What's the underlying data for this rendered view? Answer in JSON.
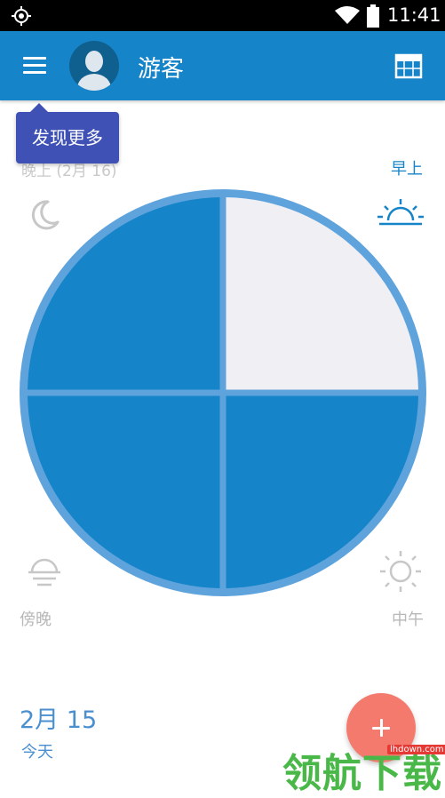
{
  "status_bar": {
    "time": "11:41"
  },
  "app_bar": {
    "user_name": "游客"
  },
  "tooltip": {
    "text": "发现更多"
  },
  "periods": {
    "evening": {
      "label": "晚上 (2月 16)",
      "icon": "moon-icon"
    },
    "morning": {
      "label": "早上",
      "icon": "sunrise-icon"
    },
    "dusk": {
      "label": "傍晚",
      "icon": "sunset-icon"
    },
    "noon": {
      "label": "中午",
      "icon": "sun-icon"
    }
  },
  "date": {
    "main": "2月 15",
    "sub": "今天"
  },
  "watermark": {
    "text": "领航下载",
    "url": "lhdown.com"
  },
  "colors": {
    "primary": "#1584c8",
    "ring": "#5fa3dd",
    "empty_quadrant": "#efeff4",
    "fab": "#f47a6e",
    "tooltip": "#3f51b5"
  },
  "chart_data": {
    "type": "pie",
    "quadrants": [
      {
        "position": "top-right",
        "filled": false
      },
      {
        "position": "bottom-right",
        "filled": true
      },
      {
        "position": "bottom-left",
        "filled": true
      },
      {
        "position": "top-left",
        "filled": true
      }
    ]
  }
}
